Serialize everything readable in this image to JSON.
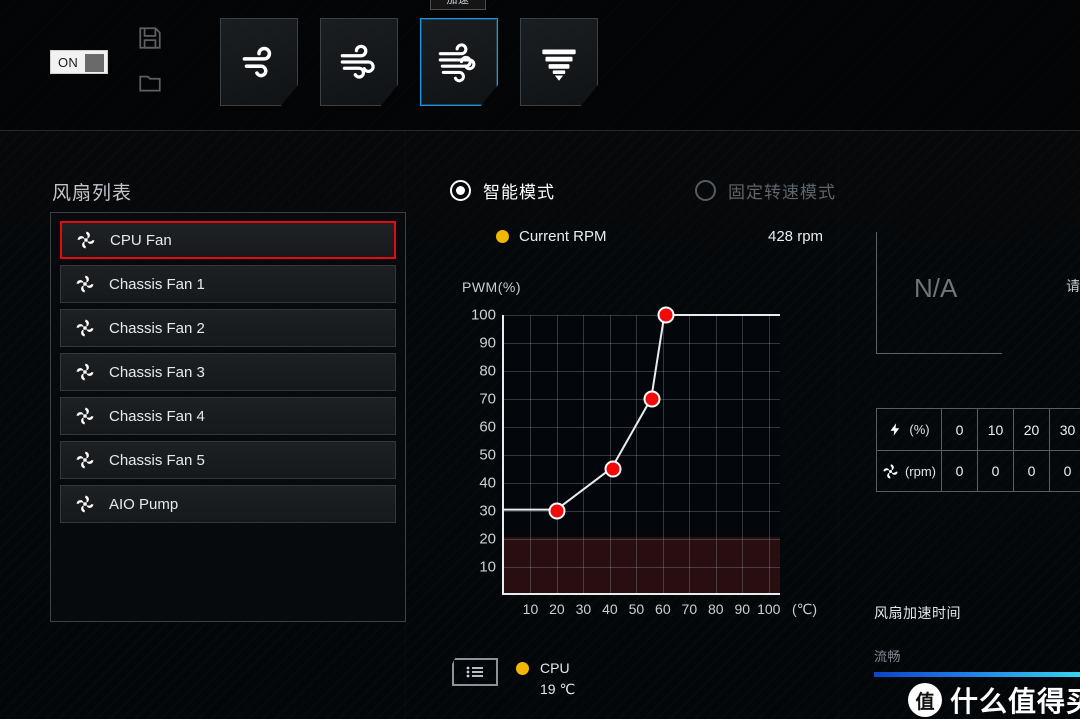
{
  "topbar": {
    "power_toggle": {
      "label": "ON",
      "state": "on"
    },
    "save_icon": "floppy-disk-icon",
    "load_icon": "folder-open-icon",
    "badge_label": "加速",
    "profiles": [
      {
        "id": "silent",
        "icon": "wind-light-icon",
        "selected": false
      },
      {
        "id": "standard",
        "icon": "wind-medium-icon",
        "selected": false
      },
      {
        "id": "turbo",
        "icon": "wind-strong-icon",
        "selected": true
      },
      {
        "id": "full",
        "icon": "tornado-icon",
        "selected": false
      }
    ]
  },
  "fan_list": {
    "title": "风扇列表",
    "items": [
      {
        "label": "CPU Fan",
        "selected": true
      },
      {
        "label": "Chassis Fan 1",
        "selected": false
      },
      {
        "label": "Chassis Fan 2",
        "selected": false
      },
      {
        "label": "Chassis Fan 3",
        "selected": false
      },
      {
        "label": "Chassis Fan 4",
        "selected": false
      },
      {
        "label": "Chassis Fan 5",
        "selected": false
      },
      {
        "label": "AIO Pump",
        "selected": false
      }
    ]
  },
  "mode": {
    "smart": {
      "label": "智能模式",
      "selected": true
    },
    "fixed": {
      "label": "固定转速模式",
      "selected": false
    }
  },
  "current_rpm": {
    "label": "Current RPM",
    "value": "428 rpm",
    "dot_color": "#f2b705"
  },
  "sensor": {
    "icon": "list-icon",
    "dot_color": "#f2b705",
    "name": "CPU",
    "temperature": "19 ℃"
  },
  "right_panel": {
    "na_text": "N/A",
    "clipped_text": "请",
    "table": {
      "rows": [
        {
          "icon": "lightning-icon",
          "unit": "(%)",
          "values": [
            "0",
            "10",
            "20",
            "30"
          ]
        },
        {
          "icon": "fan-icon",
          "unit": "(rpm)",
          "values": [
            "0",
            "0",
            "0",
            "0"
          ]
        }
      ]
    },
    "accel_label": "风扇加速时间",
    "accel_value": "流畅"
  },
  "watermark": {
    "mark": "值",
    "text": "什么值得买"
  },
  "chart_data": {
    "type": "line",
    "title": "",
    "ylabel": "PWM(%)",
    "xlabel": "(℃)",
    "xlim": [
      0,
      105
    ],
    "ylim": [
      0,
      100
    ],
    "xticks": [
      10,
      20,
      30,
      40,
      50,
      60,
      70,
      80,
      90,
      100
    ],
    "yticks": [
      10,
      20,
      30,
      40,
      50,
      60,
      70,
      80,
      90,
      100
    ],
    "grid": true,
    "low_zone": {
      "from": 0,
      "to": 20,
      "color": "#7d1e20"
    },
    "point_color": "#f20a0a",
    "line_color": "#e8ecef",
    "points": [
      {
        "x": 20,
        "y": 30
      },
      {
        "x": 41,
        "y": 45
      },
      {
        "x": 56,
        "y": 70
      },
      {
        "x": 61,
        "y": 100
      }
    ],
    "flat_left": {
      "from_x": 0,
      "to_x": 20,
      "y": 30
    },
    "flat_right": {
      "from_x": 61,
      "to_x": 105,
      "y": 100
    }
  }
}
